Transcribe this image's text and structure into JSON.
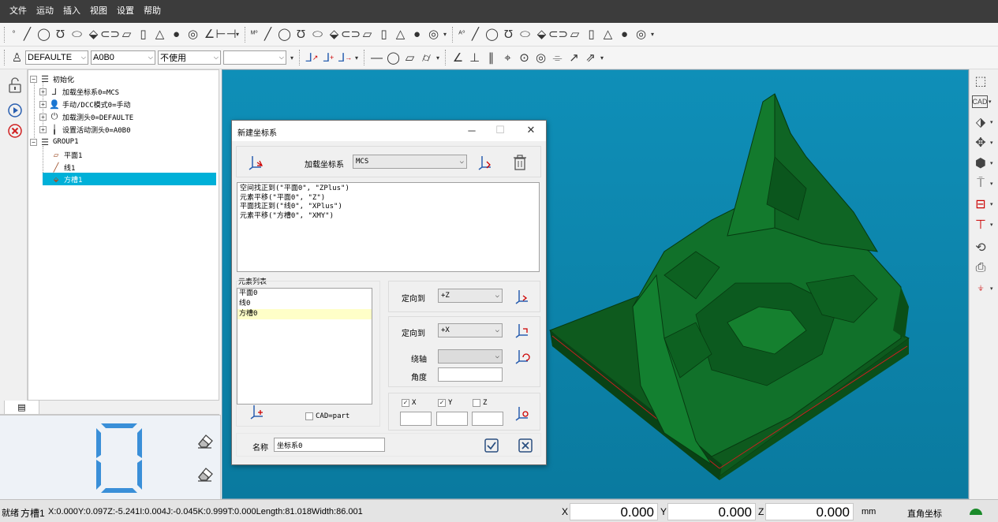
{
  "menu": [
    "文件",
    "运动",
    "插入",
    "视图",
    "设置",
    "帮助"
  ],
  "toolbar2": {
    "probe_select": "DEFAULTE",
    "angle_select": "A0B0",
    "mode_select": "不使用",
    "extra_select": ""
  },
  "tree": {
    "root1": "初始化",
    "load_cs": "加载坐标系0=MCS",
    "manual": "手动/DCC模式0=手动",
    "load_probe": "加载测头0=DEFAULTE",
    "set_probe": "设置活动测头0=A0B0",
    "group": "GROUP1",
    "plane": "平面1",
    "line": "线1",
    "slot": "方槽1"
  },
  "dialog": {
    "title": "新建坐标系",
    "load_cs_label": "加载坐标系",
    "load_cs_value": "MCS",
    "script_lines": [
      "空间找正到(\"平面0\", \"ZPlus\")",
      "元素平移(\"平面0\", \"Z\")",
      "平面找正到(\"线0\", \"XPlus\")",
      "元素平移(\"方槽0\", \"XMY\")"
    ],
    "element_list_label": "元素列表",
    "elements": [
      "平面0",
      "线0",
      "方槽0"
    ],
    "orient1_label": "定向到",
    "orient1_value": "+Z",
    "orient2_label": "定向到",
    "orient2_value": "+X",
    "axis_label": "绕轴",
    "axis_value": "",
    "angle_label": "角度",
    "angle_value": "",
    "chk_x": "X",
    "chk_y": "Y",
    "chk_z": "Z",
    "cad_label": "CAD=part",
    "name_label": "名称",
    "name_value": "坐标系0"
  },
  "status": {
    "ready": "就绪",
    "element": "方槽1",
    "info": "X:0.000Y:0.097Z:-5.241I:0.004J:-0.045K:0.999T:0.000Length:81.018Width:86.001",
    "x_label": "X",
    "x_value": "0.000",
    "y_label": "Y",
    "y_value": "0.000",
    "z_label": "Z",
    "z_value": "0.000",
    "unit": "mm",
    "coord_mode": "直角坐标"
  },
  "colors": {
    "viewport_bg": "#0f8fb8",
    "model_green": "#0e5a1e",
    "selection_blue": "#00b0d8",
    "digit_blue": "#3a8fd8"
  }
}
